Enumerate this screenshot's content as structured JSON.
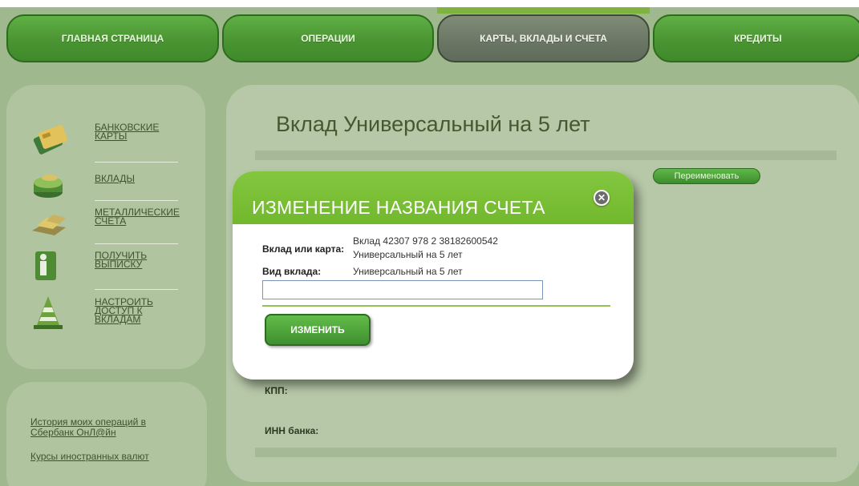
{
  "nav": {
    "tabs": [
      {
        "label": "ГЛАВНАЯ СТРАНИЦА"
      },
      {
        "label": "ОПЕРАЦИИ"
      },
      {
        "label": "КАРТЫ, ВКЛАДЫ И СЧЕТА"
      },
      {
        "label": "КРЕДИТЫ"
      }
    ],
    "active_tab": "КАРТЫ, ВКЛАДЫ И СЧЕТА"
  },
  "sidebar": {
    "items": [
      {
        "label": "БАНКОВСКИЕ КАРТЫ",
        "icon": "bank-card-icon"
      },
      {
        "label": "ВКЛАДЫ",
        "icon": "deposit-icon"
      },
      {
        "label": "МЕТАЛЛИЧЕСКИЕ СЧЕТА",
        "icon": "gold-bars-icon"
      },
      {
        "label": "ПОЛУЧИТЬ ВЫПИСКУ",
        "icon": "info-icon"
      },
      {
        "label": "НАСТРОИТЬ ДОСТУП К ВКЛАДАМ",
        "icon": "traffic-cone-icon"
      }
    ],
    "links": [
      {
        "label": "История моих операций в Сбербанк ОнЛ@йн"
      },
      {
        "label": "Курсы иностранных валют"
      }
    ]
  },
  "main": {
    "title": "Вклад Универсальный на 5 лет",
    "rename_button": "Переименовать",
    "kpp_label": "КПП:",
    "inn_label": "ИНН банка:"
  },
  "modal": {
    "title": "ИЗМЕНЕНИЕ НАЗВАНИЯ СЧЕТА",
    "deposit_label": "Вклад или карта:",
    "deposit_value_line1": "Вклад 42307 978 2 38182600542",
    "deposit_value_line2": "Универсальный на 5 лет",
    "type_label": "Вид вклада:",
    "type_value": "Универсальный на 5 лет",
    "name_input_value": "",
    "submit_button": "ИЗМЕНИТЬ"
  },
  "colors": {
    "accent_green": "#72b82d",
    "nav_green": "#4a9432",
    "page_bg": "#9fb88e"
  }
}
